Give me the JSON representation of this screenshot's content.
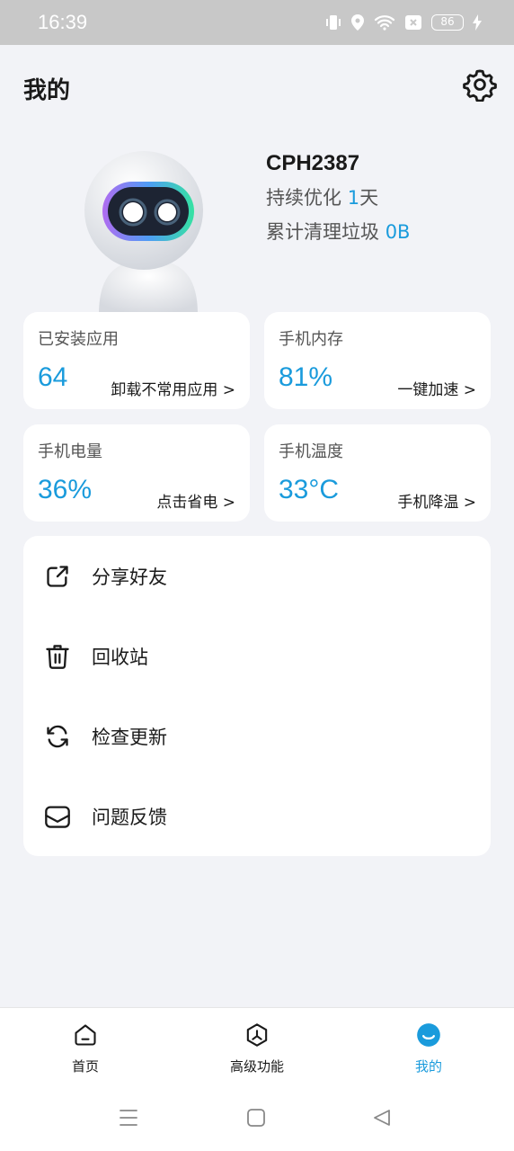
{
  "status_bar": {
    "time": "16:39",
    "battery": "86",
    "icons": [
      "vibrate-icon",
      "location-icon",
      "wifi-icon",
      "sim-off-icon",
      "battery-icon",
      "charging-icon"
    ]
  },
  "header": {
    "title": "我的",
    "settings_icon": "gear-icon"
  },
  "profile": {
    "device_name": "CPH2387",
    "optimize_prefix": "持续优化 ",
    "optimize_days": "1",
    "optimize_suffix": "天",
    "cleaned_prefix": "累计清理垃圾 ",
    "cleaned_amount": "0B"
  },
  "cards": [
    {
      "title": "已安装应用",
      "value": "64",
      "action": "卸载不常用应用 >"
    },
    {
      "title": "手机内存",
      "value": "81%",
      "action": "一键加速 >"
    },
    {
      "title": "手机电量",
      "value": "36%",
      "action": "点击省电 >"
    },
    {
      "title": "手机温度",
      "value": "33°C",
      "action": "手机降温 >"
    }
  ],
  "menu": [
    {
      "label": "分享好友",
      "icon": "share-icon"
    },
    {
      "label": "回收站",
      "icon": "trash-icon"
    },
    {
      "label": "检查更新",
      "icon": "refresh-icon"
    },
    {
      "label": "问题反馈",
      "icon": "feedback-icon"
    }
  ],
  "tabbar": [
    {
      "label": "首页",
      "icon": "home-icon",
      "active": false
    },
    {
      "label": "高级功能",
      "icon": "advanced-icon",
      "active": false
    },
    {
      "label": "我的",
      "icon": "profile-face-icon",
      "active": true
    }
  ],
  "colors": {
    "accent": "#1a9bdc",
    "background": "#f2f3f7",
    "card": "#ffffff",
    "status_bar": "#c8c8c8"
  }
}
